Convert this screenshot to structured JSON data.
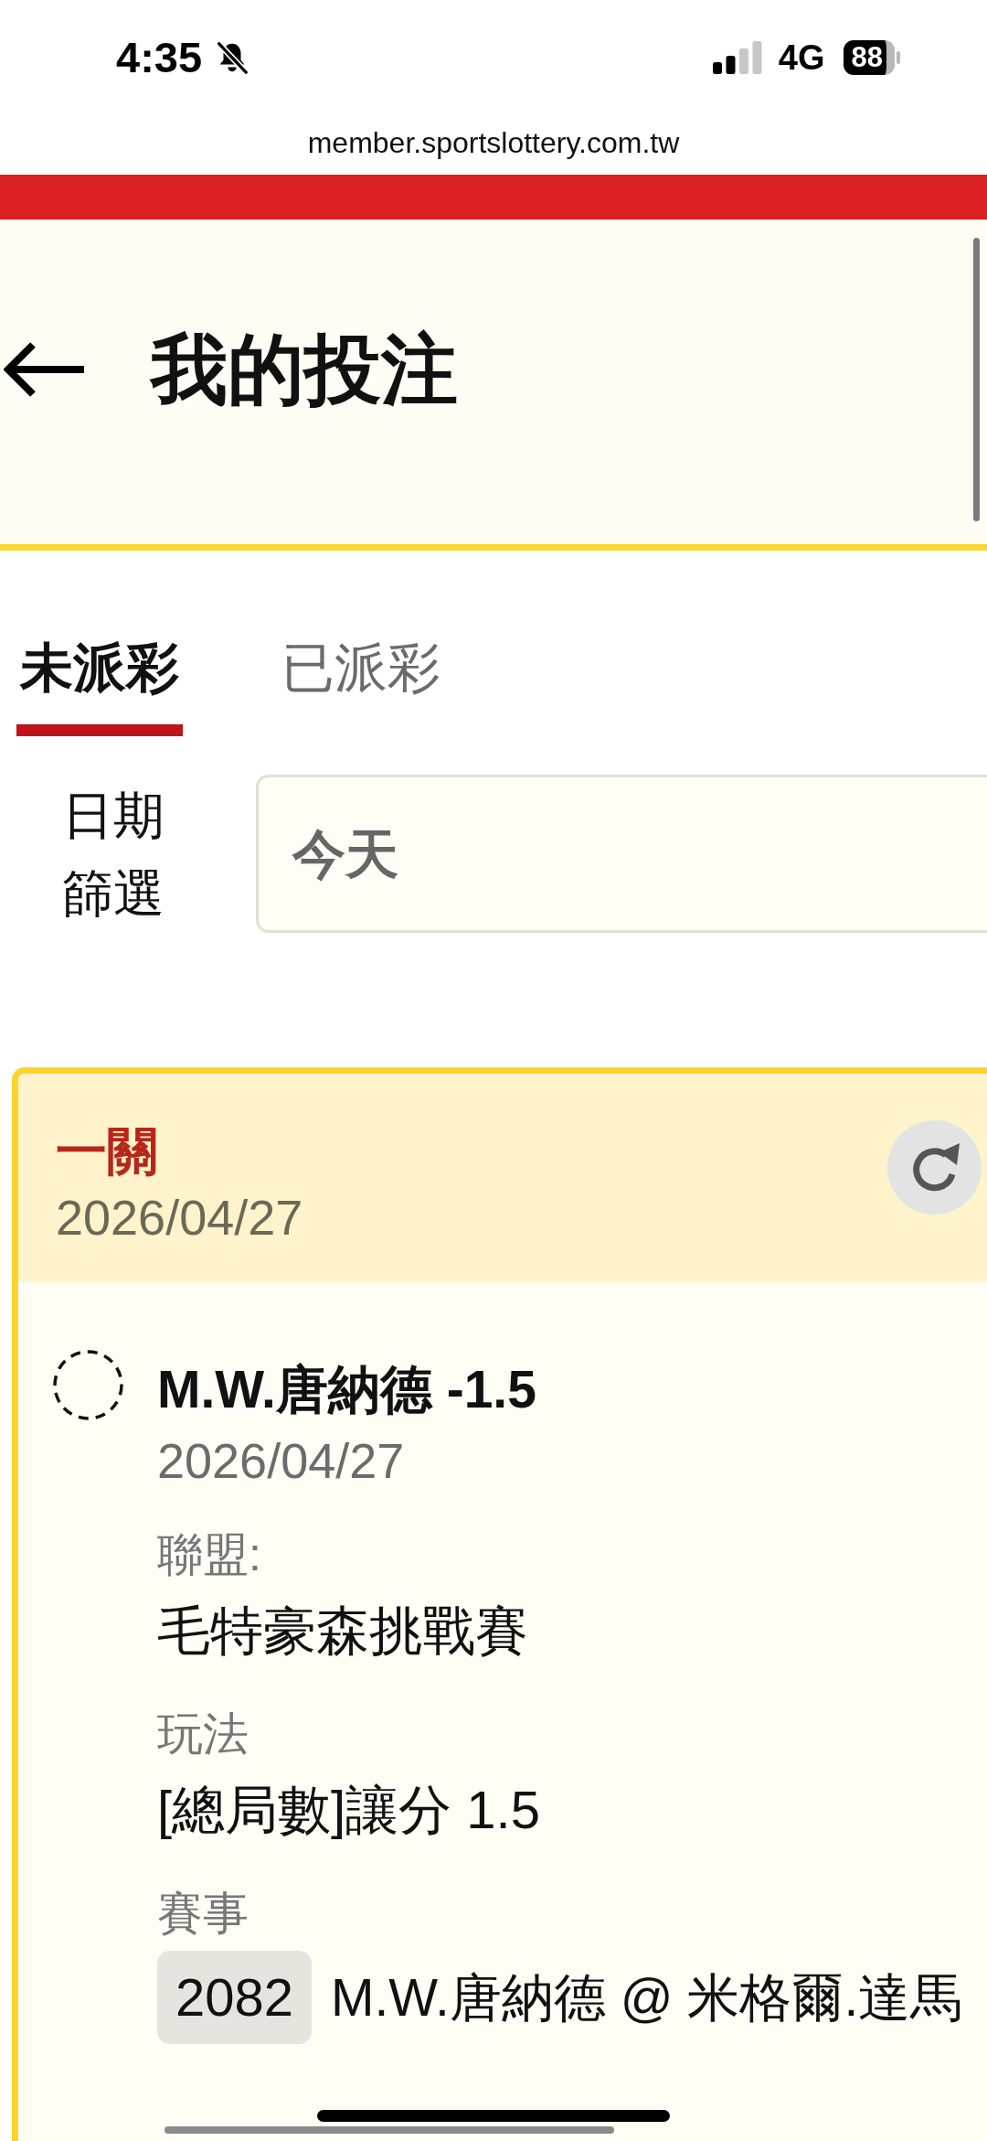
{
  "status_bar": {
    "time": "4:35",
    "network": "4G",
    "battery": "88"
  },
  "browser": {
    "url": "member.sportslottery.com.tw"
  },
  "header": {
    "title": "我的投注"
  },
  "tabs": [
    {
      "label": "未派彩",
      "selected": true
    },
    {
      "label": "已派彩",
      "selected": false
    }
  ],
  "date_filter": {
    "label": "日期篩選",
    "value": "今天"
  },
  "bets": [
    {
      "type": "一關",
      "date": "2026/04/27",
      "selections": [
        {
          "title": "M.W.唐納德 -1.5",
          "date": "2026/04/27",
          "details": [
            {
              "kind": "text",
              "label": "聯盟:",
              "value": "毛特豪森挑戰賽"
            },
            {
              "kind": "text",
              "label": "玩法",
              "value": "[總局數]讓分 1.5"
            },
            {
              "kind": "event",
              "label": "賽事",
              "code": "2082",
              "value": "M.W.唐納德 @ 米格爾.達馬"
            }
          ]
        }
      ]
    }
  ]
}
